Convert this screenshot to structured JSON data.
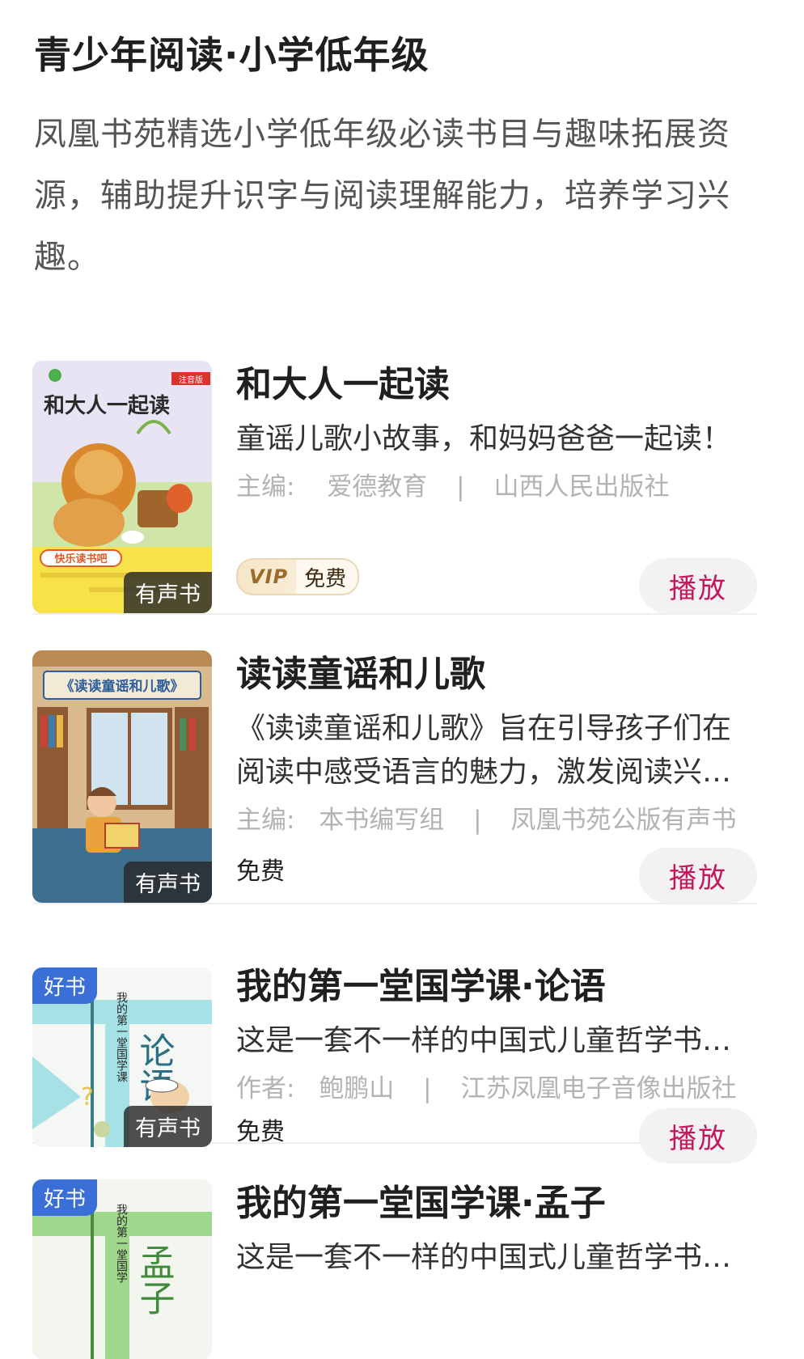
{
  "header": {
    "title": "青少年阅读·小学低年级",
    "description": "凤凰书苑精选小学低年级必读书目与趣味拓展资源，辅助提升识字与阅读理解能力，培养学习兴趣。"
  },
  "colors": {
    "play_text": "#c2185b",
    "play_bg": "#f4f1f2",
    "good_tag_bg": "#3a6fd8"
  },
  "books": [
    {
      "title": "和大人一起读",
      "description": "童谣儿歌小故事，和妈妈爸爸一起读！",
      "meta_label": "主编:",
      "author": "爱德教育",
      "publisher": "山西人民出版社",
      "audio_tag": "有声书",
      "vip_mark": "VIP",
      "price": "免费",
      "play_label": "播放",
      "cover_title": "和大人一起读",
      "cover_banner": "快乐读书吧",
      "cover_top_tag": "注音版"
    },
    {
      "title": "读读童谣和儿歌",
      "description": "《读读童谣和儿歌》旨在引导孩子们在阅读中感受语言的魅力，激发阅读兴…",
      "meta_label": "主编:",
      "author": "本书编写组",
      "publisher": "凤凰书苑公版有声书",
      "audio_tag": "有声书",
      "price": "免费",
      "play_label": "播放",
      "cover_title": "《读读童谣和儿歌》"
    },
    {
      "title": "我的第一堂国学课·论语",
      "description": "这是一套不一样的中国式儿童哲学书…",
      "meta_label": "作者:",
      "author": "鲍鹏山",
      "publisher": "江苏凤凰电子音像出版社",
      "good_tag": "好书",
      "audio_tag": "有声书",
      "price": "免费",
      "play_label": "播放",
      "cover_title": "论语",
      "cover_vertical": "我的第一堂国学课"
    },
    {
      "title": "我的第一堂国学课·孟子",
      "description": "这是一套不一样的中国式儿童哲学书…",
      "good_tag": "好书",
      "cover_title": "孟子",
      "cover_vertical": "我的第一堂国学"
    }
  ]
}
